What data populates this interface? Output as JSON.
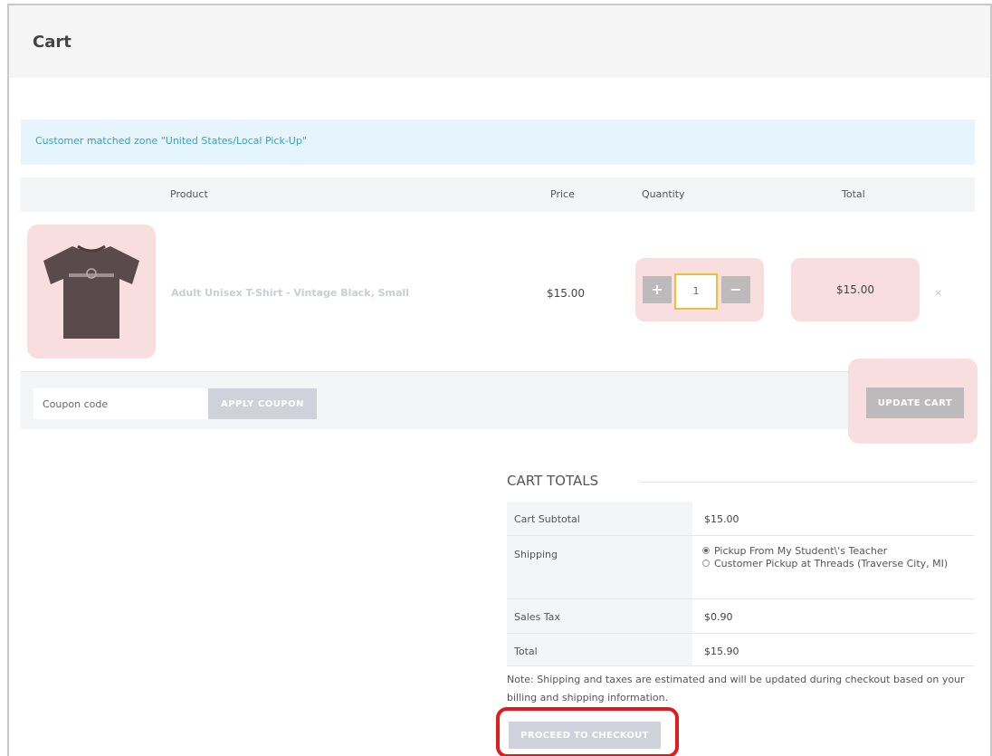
{
  "page": {
    "title": "Cart"
  },
  "notice": {
    "text": "Customer matched zone \"United States/Local Pick-Up\""
  },
  "table": {
    "headers": {
      "product": "Product",
      "price": "Price",
      "quantity": "Quantity",
      "total": "Total"
    },
    "items": [
      {
        "name": "Adult Unisex T-Shirt - Vintage Black, Small",
        "price": "$15.00",
        "quantity": "1",
        "total": "$15.00",
        "plus_glyph": "+",
        "minus_glyph": "−",
        "remove_glyph": "×"
      }
    ]
  },
  "actions": {
    "coupon_placeholder": "Coupon code",
    "apply_label": "APPLY COUPON",
    "update_label": "UPDATE CART"
  },
  "totals": {
    "title": "CART TOTALS",
    "subtotal_label": "Cart Subtotal",
    "subtotal_value": "$15.00",
    "shipping_label": "Shipping",
    "shipping_options": [
      {
        "label": "Pickup From My Student\\'s Teacher",
        "selected": true
      },
      {
        "label": "Customer Pickup at Threads (Traverse City, MI)",
        "selected": false
      }
    ],
    "tax_label": "Sales Tax",
    "tax_value": "$0.90",
    "total_label": "Total",
    "total_value": "$15.90",
    "note": "Note: Shipping and taxes are estimated and will be updated during checkout based on your billing and shipping information.",
    "checkout_label": "PROCEED TO CHECKOUT"
  },
  "colors": {
    "highlight_pink": "#f8dede",
    "notice_bg": "#e5f5fb",
    "notice_text": "#3a9fc3",
    "checkout_outline": "#e01d1d",
    "qty_border": "#e5c33a"
  },
  "icons": {
    "tshirt": "tshirt-image",
    "remove": "remove-icon",
    "radio": "radio-icon"
  }
}
